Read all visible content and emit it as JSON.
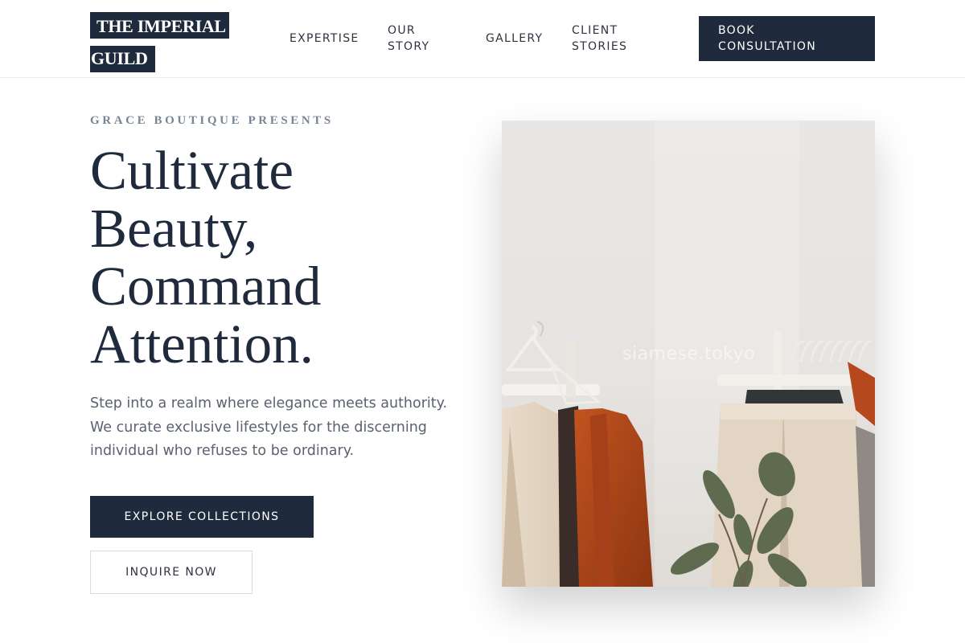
{
  "header": {
    "logo_line1": "THE IMPERIAL",
    "logo_line2": "GUILD",
    "nav": [
      {
        "label": "EXPERTISE"
      },
      {
        "label": "OUR STORY"
      },
      {
        "label": "GALLERY"
      },
      {
        "label": "CLIENT STORIES"
      }
    ],
    "book_button": "BOOK CONSULTATION"
  },
  "hero": {
    "eyebrow": "GRACE BOUTIQUE PRESENTS",
    "headline_line1": "Cultivate",
    "headline_line2": "Beauty,",
    "headline_line3": "Command",
    "headline_line4": "Attention.",
    "lead": "Step into a realm where elegance meets authority. We curate exclusive lifestyles for the discerning individual who refuses to be ordinary.",
    "explore_button": "EXPLORE COLLECTIONS",
    "inquire_button": "INQUIRE NOW",
    "image_watermark": "siamese.tokyo"
  },
  "colors": {
    "navy": "#1f2a3c",
    "muted_text": "#5a6170",
    "eyebrow": "#7a8594",
    "rust_garment": "#b5481c"
  }
}
